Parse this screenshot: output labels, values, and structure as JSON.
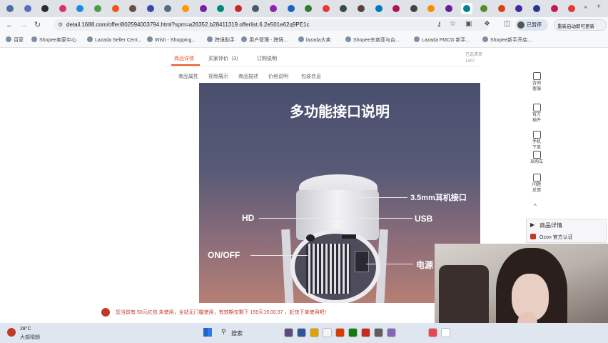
{
  "browser": {
    "url": "detail.1688.com/offer/802594003794.html?spm=a26352.b28411319.offerlist.6.2e501e62q9PE1c",
    "status_button": "已暂停",
    "menu_button": "重新启动即可更新",
    "tabs": [
      {
        "color": "#4a6fa5"
      },
      {
        "color": "#5c6ac4"
      },
      {
        "color": "#2b2b2b"
      },
      {
        "color": "#d6336c"
      },
      {
        "color": "#1e88e5"
      },
      {
        "color": "#43a047"
      },
      {
        "color": "#f4511e"
      },
      {
        "color": "#6d4c41"
      },
      {
        "color": "#3949ab"
      },
      {
        "color": "#546e7a"
      },
      {
        "color": "#ff9800"
      },
      {
        "color": "#7b1fa2"
      },
      {
        "color": "#00897b"
      },
      {
        "color": "#c62828"
      },
      {
        "color": "#455a64"
      },
      {
        "color": "#8e24aa"
      },
      {
        "color": "#1565c0"
      },
      {
        "color": "#2e7d32"
      },
      {
        "color": "#e53935"
      },
      {
        "color": "#37474f"
      },
      {
        "color": "#5d4037"
      },
      {
        "color": "#0277bd"
      },
      {
        "color": "#ad1457"
      },
      {
        "color": "#424242"
      },
      {
        "color": "#fb8c00"
      },
      {
        "color": "#6a1b9a"
      },
      {
        "color": "#00838f"
      },
      {
        "color": "#558b2f"
      },
      {
        "color": "#d84315"
      },
      {
        "color": "#4527a0"
      },
      {
        "color": "#283593"
      },
      {
        "color": "#c2185b"
      },
      {
        "color": "#e53935"
      }
    ]
  },
  "bookmarks": [
    "百家",
    "Shopee卖家中心",
    "Lazada Seller Cent...",
    "Wish - Shopping...",
    "跨境助手",
    "用户管理 - 跨境...",
    "lazada大卖",
    "Shopee东南亚与台...",
    "Lazada FMCG 新手...",
    "Shopee新手开店..."
  ],
  "page": {
    "nav_tabs": [
      "商品详情",
      "买家评价（3）",
      "订购说明"
    ],
    "sub_tabs": [
      "商品属性",
      "视频展示",
      "商品描述",
      "价格说明",
      "包装信息"
    ],
    "side_note": "已选清单\n1407",
    "poster": {
      "title": "多功能接口说明",
      "labels": {
        "earphone": "3.5mm耳机接口",
        "hd": "HD",
        "usb": "USB",
        "onoff": "ON/OFF",
        "power": "电源"
      }
    }
  },
  "sidebar": {
    "items": [
      "咨询\n客服",
      "官方\n插件",
      "手机\n下单",
      "采购车",
      "问题\n反馈"
    ],
    "panel_title": "商品详情",
    "panel_sub": "Ozon 官方认证"
  },
  "notice": {
    "text": "您当前有  50元红包  未使用，全站无门槛使用，有效期仅剩下  159天15:00:37  ，赶快下单使用吧！"
  },
  "taskbar": {
    "weather_temp": "28°C",
    "weather_desc": "大部晴朗",
    "search": "搜索"
  }
}
